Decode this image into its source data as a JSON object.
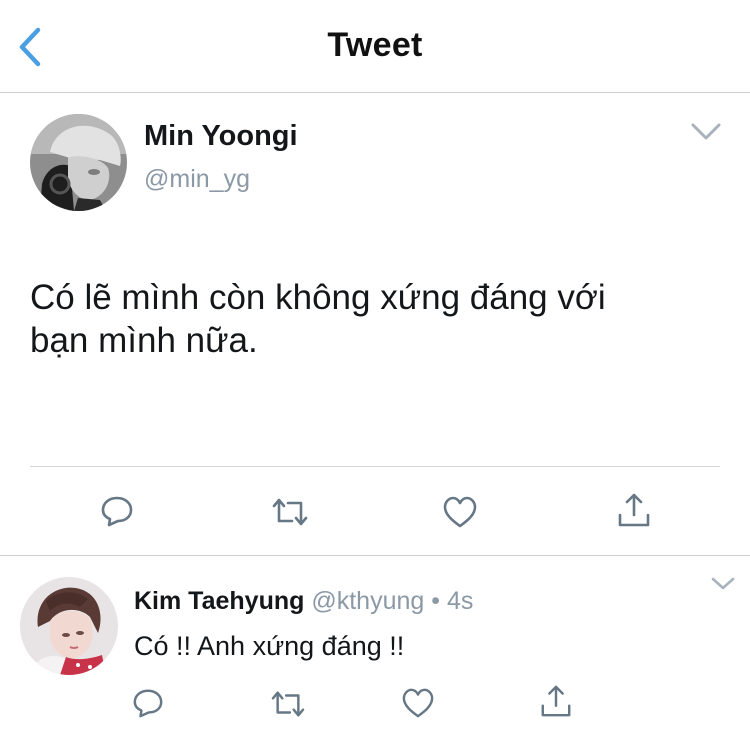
{
  "header": {
    "title": "Tweet",
    "back_icon": "chevron-left-icon",
    "accent_color": "#4a9fe3"
  },
  "tweet": {
    "author_name": "Min Yoongi",
    "author_handle": "@min_yg",
    "text_line1": "Có lẽ mình còn không xứng đáng với",
    "text_line2": "bạn mình nữa.",
    "actions": [
      "reply-icon",
      "retweet-icon",
      "like-icon",
      "share-icon"
    ]
  },
  "reply": {
    "author_name": "Kim Taehyung",
    "author_handle": "@kthyung",
    "separator": "•",
    "time": "4s",
    "text": "Có !! Anh xứng đáng !!",
    "actions": [
      "reply-icon",
      "retweet-icon",
      "like-icon",
      "share-icon"
    ]
  },
  "colors": {
    "text": "#14171a",
    "secondary_text": "#8b98a5",
    "icon": "#667786",
    "divider": "#d6d6d6"
  }
}
